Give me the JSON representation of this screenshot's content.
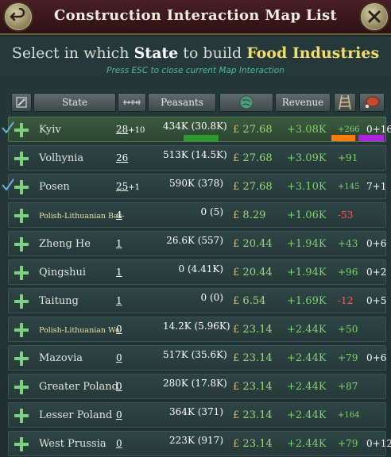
{
  "window": {
    "title": "Construction Interaction Map List",
    "back_icon": "back-arrow-icon",
    "close_icon": "close-x-icon"
  },
  "prompt": {
    "prefix": "Select in which ",
    "state_word": "State",
    "middle": " to build ",
    "building": "Food Industries",
    "hint": "Press ESC to close current Map Interaction"
  },
  "header": {
    "state": "State",
    "peasants": "Peasants",
    "revenue": "Revenue"
  },
  "colors": {
    "accent_green": "#7fd46f",
    "negative": "#ff5a5a",
    "gold": "#f2dd6b",
    "peasant_bar": "#2e9a2e",
    "orange_bar": "#ff7a00",
    "purple_bar": "#b021e0"
  },
  "rows": [
    {
      "name": "Kyiv",
      "count": "28",
      "count_extra": "+10",
      "peasants": "434K (30.8K)",
      "money": "27.68",
      "revenue": "+3.08K",
      "delta": "+266",
      "extra": "0+16",
      "checked": true,
      "bars": true
    },
    {
      "name": "Volhynia",
      "count": "26",
      "count_extra": "",
      "peasants": "513K (14.5K)",
      "money": "27.68",
      "revenue": "+3.09K",
      "delta": "+91",
      "extra": "",
      "checked": false
    },
    {
      "name": "Posen",
      "count": "25",
      "count_extra": "+1",
      "peasants": "590K (378)",
      "money": "27.68",
      "revenue": "+3.10K",
      "delta": "+145",
      "extra": "7+1",
      "checked": true
    },
    {
      "name": "Polish-Lithuanian Bas-",
      "count": "4",
      "count_extra": "",
      "peasants": "0 (5)",
      "money": "8.29",
      "revenue": "+1.06K",
      "delta": "-53",
      "extra": "",
      "checked": false
    },
    {
      "name": "Zheng He",
      "count": "1",
      "count_extra": "",
      "peasants": "26.6K (557)",
      "money": "20.44",
      "revenue": "+1.94K",
      "delta": "+43",
      "extra": "0+6",
      "checked": false
    },
    {
      "name": "Qingshui",
      "count": "1",
      "count_extra": "",
      "peasants": "0 (4.41K)",
      "money": "20.44",
      "revenue": "+1.94K",
      "delta": "+96",
      "extra": "0+2",
      "checked": false
    },
    {
      "name": "Taitung",
      "count": "1",
      "count_extra": "",
      "peasants": "0 (0)",
      "money": "6.54",
      "revenue": "+1.69K",
      "delta": "-12",
      "extra": "0+5",
      "checked": false
    },
    {
      "name": "Polish-Lithuanian We",
      "count": "0",
      "count_extra": "",
      "peasants": "14.2K (5.96K)",
      "money": "23.14",
      "revenue": "+2.44K",
      "delta": "+50",
      "extra": "",
      "checked": false
    },
    {
      "name": "Mazovia",
      "count": "0",
      "count_extra": "",
      "peasants": "517K (35.6K)",
      "money": "23.14",
      "revenue": "+2.44K",
      "delta": "+79",
      "extra": "0+6",
      "checked": false
    },
    {
      "name": "Greater Poland",
      "count": "0",
      "count_extra": "",
      "peasants": "280K (17.8K)",
      "money": "23.14",
      "revenue": "+2.44K",
      "delta": "+87",
      "extra": "",
      "checked": false
    },
    {
      "name": "Lesser Poland",
      "count": "0",
      "count_extra": "",
      "peasants": "364K (371)",
      "money": "23.14",
      "revenue": "+2.44K",
      "delta": "+164",
      "extra": "",
      "checked": false
    },
    {
      "name": "West Prussia",
      "count": "0",
      "count_extra": "",
      "peasants": "223K (917)",
      "money": "23.14",
      "revenue": "+2.44K",
      "delta": "+79",
      "extra": "0+12",
      "checked": false
    }
  ],
  "pound_symbol": "£"
}
